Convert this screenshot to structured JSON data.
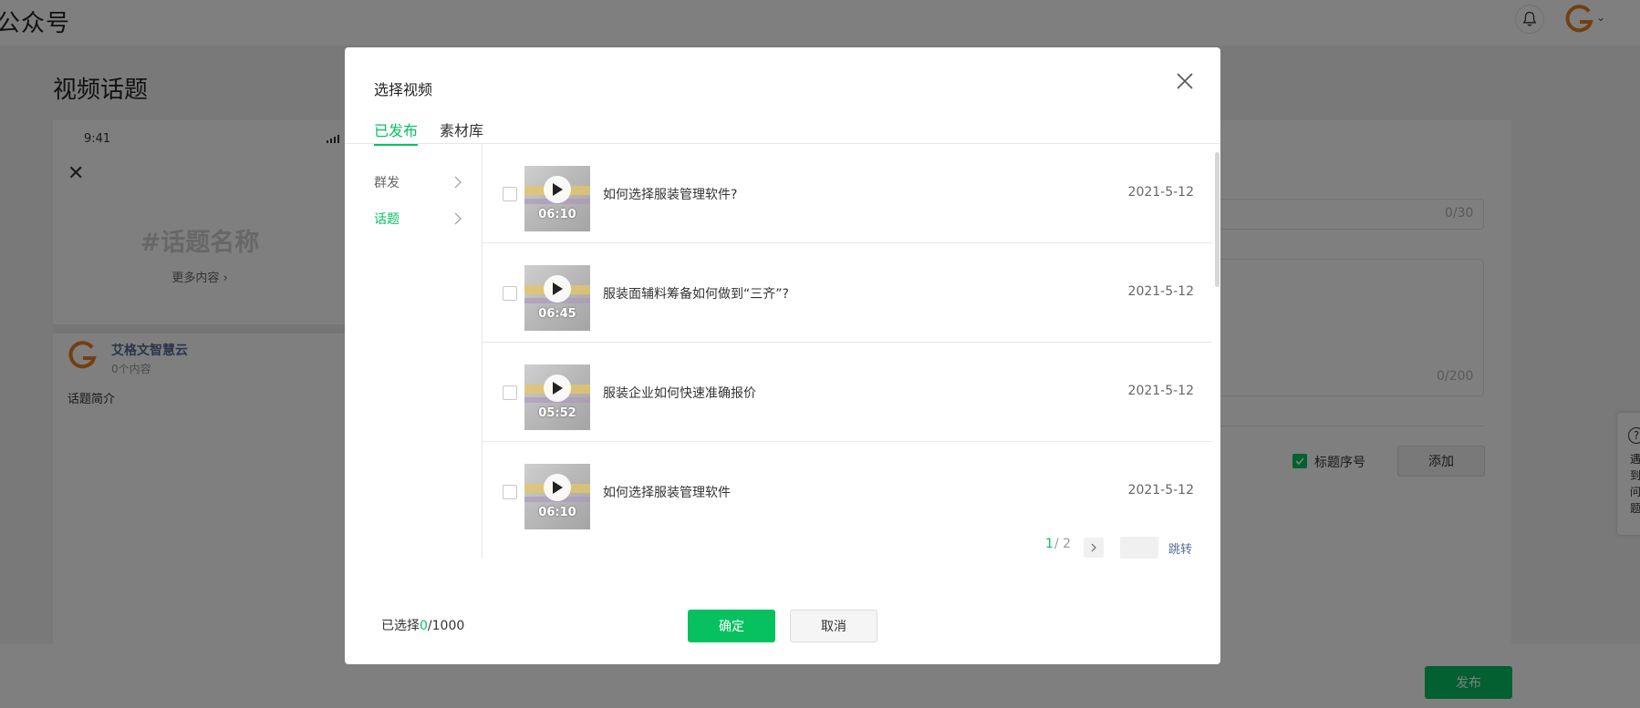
{
  "app": {
    "brand": "公众号",
    "page_title": "视频话题"
  },
  "preview": {
    "time": "9:41",
    "topic_name": "#话题名称",
    "more_content": "更多内容 ›",
    "account_name": "艾格文智慧云",
    "account_count": "0个内容",
    "topic_intro": "话题简介"
  },
  "form": {
    "title_counter": "0/30",
    "intro_counter": "0/200",
    "numbering_label": "标题序号",
    "add_label": "添加",
    "publish_label": "发布"
  },
  "help": {
    "symbol": "?",
    "text": "遇到问题"
  },
  "dialog": {
    "title": "选择视频",
    "tabs": [
      {
        "label": "已发布"
      },
      {
        "label": "素材库"
      }
    ],
    "nav": [
      {
        "label": "群发"
      },
      {
        "label": "话题"
      }
    ],
    "videos": [
      {
        "title": "如何选择服装管理软件?",
        "duration": "06:10",
        "date": "2021-5-12"
      },
      {
        "title": "服装面辅料筹备如何做到“三齐”?",
        "duration": "06:45",
        "date": "2021-5-12"
      },
      {
        "title": "服装企业如何快速准确报价",
        "duration": "05:52",
        "date": "2021-5-12"
      },
      {
        "title": "如何选择服装管理软件",
        "duration": "06:10",
        "date": "2021-5-12"
      }
    ],
    "pager": {
      "current": "1",
      "total": "/ 2",
      "jump_label": "跳转"
    },
    "selection": {
      "prefix": "已选择",
      "count": "0",
      "suffix": "/1000"
    },
    "confirm_label": "确定",
    "cancel_label": "取消"
  },
  "colors": {
    "accent": "#07c160",
    "link": "#576b95",
    "overlay": "rgba(0,0,0,0.5)"
  },
  "icons": [
    "bell-icon",
    "close-icon",
    "chevron-right-icon",
    "play-icon",
    "signal-icon",
    "help-icon",
    "check-icon"
  ]
}
